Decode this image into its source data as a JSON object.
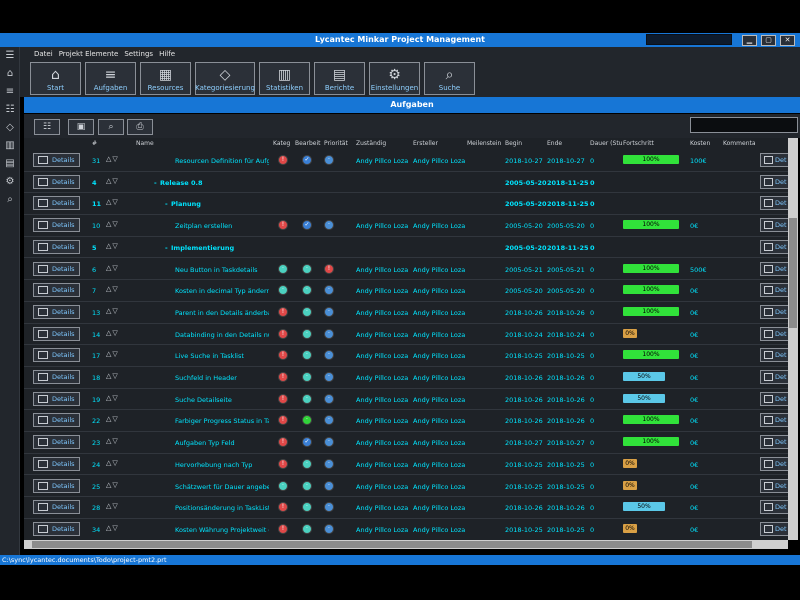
{
  "window": {
    "title": "Lycantec Minkar Project Management"
  },
  "menu": [
    "Datei",
    "Projekt Elemente",
    "Settings",
    "Hilfe"
  ],
  "toolbar": [
    {
      "label": "Start",
      "icon": "home-icon"
    },
    {
      "label": "Aufgaben",
      "icon": "list-icon"
    },
    {
      "label": "Resources",
      "icon": "resources-icon"
    },
    {
      "label": "Kategoriesierung",
      "icon": "tag-icon"
    },
    {
      "label": "Statistiken",
      "icon": "chart-icon"
    },
    {
      "label": "Berichte",
      "icon": "report-icon"
    },
    {
      "label": "Einstellungen",
      "icon": "gear-icon"
    },
    {
      "label": "Suche",
      "icon": "search-icon"
    }
  ],
  "section_title": "Aufgaben",
  "columns": [
    "#",
    "Name",
    "Kateg",
    "Bearbeit",
    "Priorität",
    "Zuständig",
    "Ersteller",
    "Meilenstein",
    "Begin",
    "Ende",
    "Dauer (Stu",
    "Fortschritt",
    "Kosten",
    "Kommentar"
  ],
  "details_label": "Details",
  "right_details_label": "Det",
  "status_colors": {
    "red": "#e04848",
    "teal": "#4bd1c0",
    "blue": "#4a8fd6",
    "green": "#31d33a",
    "orange": "#e07a3a"
  },
  "rows": [
    {
      "id": "31",
      "name": "Resourcen Definition für Aufgat",
      "kind": "task",
      "icons": [
        "red",
        "check",
        "blue"
      ],
      "zust": "Andy Pillco Loza",
      "erst": "Andy Pillco Loza",
      "begin": "2018-10-27",
      "ende": "2018-10-27",
      "dauer": "0",
      "prog": "100%",
      "pcolor": "#31e23a",
      "pval": 100,
      "kosten": "100€"
    },
    {
      "id": "4",
      "name": "Release 0.8",
      "kind": "group",
      "prefix": "-",
      "icons": [],
      "zust": "",
      "erst": "",
      "begin": "2005-05-20",
      "ende": "2018-11-25",
      "dauer": "0",
      "prog": "",
      "pval": 0,
      "kosten": ""
    },
    {
      "id": "11",
      "name": "Planung",
      "kind": "group",
      "prefix": "-",
      "icons": [],
      "zust": "",
      "erst": "",
      "begin": "2005-05-20",
      "ende": "2018-11-25",
      "dauer": "0",
      "prog": "",
      "pval": 0,
      "kosten": ""
    },
    {
      "id": "10",
      "name": "Zeitplan erstellen",
      "kind": "task",
      "icons": [
        "red",
        "check",
        "blue"
      ],
      "zust": "Andy Pillco Loza",
      "erst": "Andy Pillco Loza",
      "begin": "2005-05-20",
      "ende": "2005-05-20",
      "dauer": "0",
      "prog": "100%",
      "pcolor": "#31e23a",
      "pval": 100,
      "kosten": "0€"
    },
    {
      "id": "5",
      "name": "Implementierung",
      "kind": "group",
      "prefix": "-",
      "icons": [],
      "zust": "",
      "erst": "",
      "begin": "2005-05-20",
      "ende": "2018-11-25",
      "dauer": "0",
      "prog": "",
      "pval": 0,
      "kosten": ""
    },
    {
      "id": "6",
      "name": "Neu Button in Taskdetails",
      "kind": "task",
      "icons": [
        "teal",
        "teal",
        "red"
      ],
      "zust": "Andy Pillco Loza",
      "erst": "Andy Pillco Loza",
      "begin": "2005-05-21",
      "ende": "2005-05-21",
      "dauer": "0",
      "prog": "100%",
      "pcolor": "#31e23a",
      "pval": 100,
      "kosten": "500€"
    },
    {
      "id": "7",
      "name": "Kosten in decimal Typ ändern",
      "kind": "task",
      "icons": [
        "teal",
        "teal",
        "blue"
      ],
      "zust": "Andy Pillco Loza",
      "erst": "Andy Pillco Loza",
      "begin": "2005-05-20",
      "ende": "2005-05-20",
      "dauer": "0",
      "prog": "100%",
      "pcolor": "#31e23a",
      "pval": 100,
      "kosten": "0€"
    },
    {
      "id": "13",
      "name": "Parent in den Details änderbar",
      "kind": "task",
      "icons": [
        "red",
        "teal",
        "blue"
      ],
      "zust": "Andy Pillco Loza",
      "erst": "Andy Pillco Loza",
      "begin": "2018-10-26",
      "ende": "2018-10-26",
      "dauer": "0",
      "prog": "100%",
      "pcolor": "#31e23a",
      "pval": 100,
      "kosten": "0€"
    },
    {
      "id": "14",
      "name": "Databinding in den Details nutz",
      "kind": "task",
      "icons": [
        "red",
        "teal",
        "blue"
      ],
      "zust": "Andy Pillco Loza",
      "erst": "Andy Pillco Loza",
      "begin": "2018-10-24",
      "ende": "2018-10-24",
      "dauer": "0",
      "prog": "0%",
      "pcolor": "#d9a045",
      "pval": 0,
      "kosten": "0€"
    },
    {
      "id": "17",
      "name": "Live Suche in Tasklist",
      "kind": "task",
      "icons": [
        "red",
        "teal",
        "blue"
      ],
      "zust": "Andy Pillco Loza",
      "erst": "Andy Pillco Loza",
      "begin": "2018-10-25",
      "ende": "2018-10-25",
      "dauer": "0",
      "prog": "100%",
      "pcolor": "#31e23a",
      "pval": 100,
      "kosten": "0€"
    },
    {
      "id": "18",
      "name": "Suchfeld in Header",
      "kind": "task",
      "icons": [
        "red",
        "teal",
        "blue"
      ],
      "zust": "Andy Pillco Loza",
      "erst": "Andy Pillco Loza",
      "begin": "2018-10-26",
      "ende": "2018-10-26",
      "dauer": "0",
      "prog": "50%",
      "pcolor": "#5bc8e8",
      "pval": 50,
      "kosten": "0€"
    },
    {
      "id": "19",
      "name": "Suche Detailseite",
      "kind": "task",
      "icons": [
        "red",
        "teal",
        "blue"
      ],
      "zust": "Andy Pillco Loza",
      "erst": "Andy Pillco Loza",
      "begin": "2018-10-26",
      "ende": "2018-10-26",
      "dauer": "0",
      "prog": "50%",
      "pcolor": "#5bc8e8",
      "pval": 50,
      "kosten": "0€"
    },
    {
      "id": "22",
      "name": "Farbiger Progress Status in Task",
      "kind": "task",
      "icons": [
        "red",
        "green",
        "blue"
      ],
      "zust": "Andy Pillco Loza",
      "erst": "Andy Pillco Loza",
      "begin": "2018-10-26",
      "ende": "2018-10-26",
      "dauer": "0",
      "prog": "100%",
      "pcolor": "#31e23a",
      "pval": 100,
      "kosten": "0€"
    },
    {
      "id": "23",
      "name": "Aufgaben Typ Feld",
      "kind": "task",
      "icons": [
        "red",
        "check",
        "blue"
      ],
      "zust": "Andy Pillco Loza",
      "erst": "Andy Pillco Loza",
      "begin": "2018-10-27",
      "ende": "2018-10-27",
      "dauer": "0",
      "prog": "100%",
      "pcolor": "#31e23a",
      "pval": 100,
      "kosten": "0€"
    },
    {
      "id": "24",
      "name": "Hervorhebung nach Typ",
      "kind": "task",
      "icons": [
        "red",
        "teal",
        "blue"
      ],
      "zust": "Andy Pillco Loza",
      "erst": "Andy Pillco Loza",
      "begin": "2018-10-25",
      "ende": "2018-10-25",
      "dauer": "0",
      "prog": "0%",
      "pcolor": "#d9a045",
      "pval": 0,
      "kosten": "0€"
    },
    {
      "id": "25",
      "name": "Schätzwert für Dauer angeben",
      "kind": "task",
      "icons": [
        "teal",
        "teal",
        "blue"
      ],
      "zust": "Andy Pillco Loza",
      "erst": "Andy Pillco Loza",
      "begin": "2018-10-25",
      "ende": "2018-10-25",
      "dauer": "0",
      "prog": "0%",
      "pcolor": "#d9a045",
      "pval": 0,
      "kosten": "0€"
    },
    {
      "id": "28",
      "name": "Positionsänderung in TaskList",
      "kind": "task",
      "icons": [
        "red",
        "teal",
        "blue"
      ],
      "zust": "Andy Pillco Loza",
      "erst": "Andy Pillco Loza",
      "begin": "2018-10-26",
      "ende": "2018-10-26",
      "dauer": "0",
      "prog": "50%",
      "pcolor": "#5bc8e8",
      "pval": 50,
      "kosten": "0€"
    },
    {
      "id": "34",
      "name": "Kosten Währung Projektweit de",
      "kind": "task",
      "icons": [
        "red",
        "teal",
        "blue"
      ],
      "zust": "Andy Pillco Loza",
      "erst": "Andy Pillco Loza",
      "begin": "2018-10-25",
      "ende": "2018-10-25",
      "dauer": "0",
      "prog": "0%",
      "pcolor": "#d9a045",
      "pval": 0,
      "kosten": "0€"
    }
  ],
  "status_path": "C:\\sync\\lycantec.documents\\Todo\\project-pmt2.prt"
}
